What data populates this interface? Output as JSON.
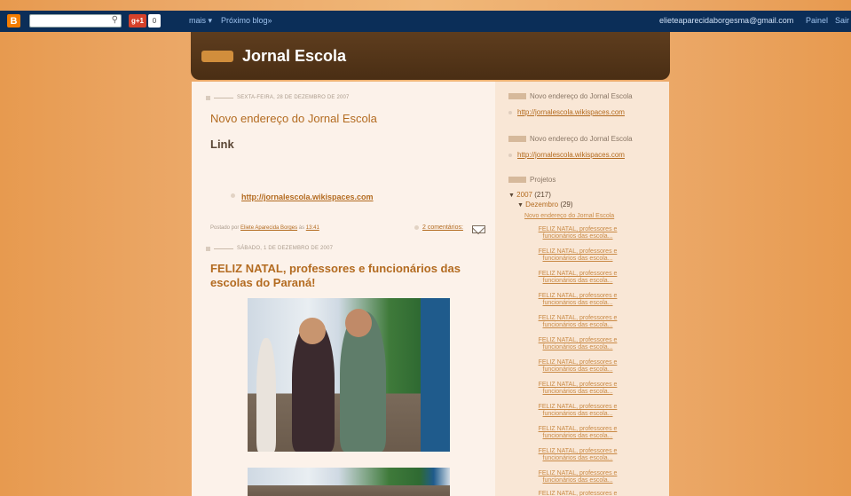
{
  "navbar": {
    "search_icon": "search-icon",
    "gplus_label": "g+1",
    "gplus_count": "0",
    "mais": "mais ▾",
    "proximo": "Próximo blog»",
    "email": "elieteaparecidaborgesma@gmail.com",
    "painel": "Painel",
    "sair": "Sair"
  },
  "header": {
    "title": "Jornal Escola"
  },
  "posts": [
    {
      "date": "SEXTA-FEIRA, 28 DE DEZEMBRO DE 2007",
      "title": "Novo endereço do Jornal Escola",
      "heading": "Link",
      "link": "http://jornalescola.wikispaces.com",
      "posted_by": "Postado por",
      "author": "Eliete Aparecida Borges",
      "at": "às",
      "time": "13:41",
      "comments": "2 comentários:"
    },
    {
      "date": "SÁBADO, 1 DE DEZEMBRO DE 2007",
      "title_line1": "FELIZ NATAL, professores e funcionários das",
      "title_line2": "escolas do Paraná!"
    }
  ],
  "sidebar": {
    "block1_title": "Novo endereço do Jornal Escola",
    "block1_link": "http://jornalescola.wikispaces.com",
    "block2_title": "Novo endereço do Jornal Escola",
    "block2_link": "http://jornalescola.wikispaces.com",
    "projetos": "Projetos",
    "year": "2007",
    "year_count": "(217)",
    "month": "Dezembro",
    "month_count": "(29)",
    "first_item": "Novo endereço do Jornal Escola",
    "items": [
      "FELIZ NATAL, professores e funcionários das escola...",
      "FELIZ NATAL, professores e funcionários das escola...",
      "FELIZ NATAL, professores e funcionários das escola...",
      "FELIZ NATAL, professores e funcionários das escola...",
      "FELIZ NATAL, professores e funcionários das escola...",
      "FELIZ NATAL, professores e funcionários das escola...",
      "FELIZ NATAL, professores e funcionários das escola...",
      "FELIZ NATAL, professores e funcionários das escola...",
      "FELIZ NATAL, professores e funcionários das escola...",
      "FELIZ NATAL, professores e funcionários das escola...",
      "FELIZ NATAL, professores e funcionários das escola...",
      "FELIZ NATAL, professores e funcionários das escola...",
      "FELIZ NATAL, professores e funcionários das escola..."
    ]
  },
  "colors": {
    "accent": "#b36b20",
    "navbar": "#0b2e58",
    "header": "#4a2e14"
  }
}
